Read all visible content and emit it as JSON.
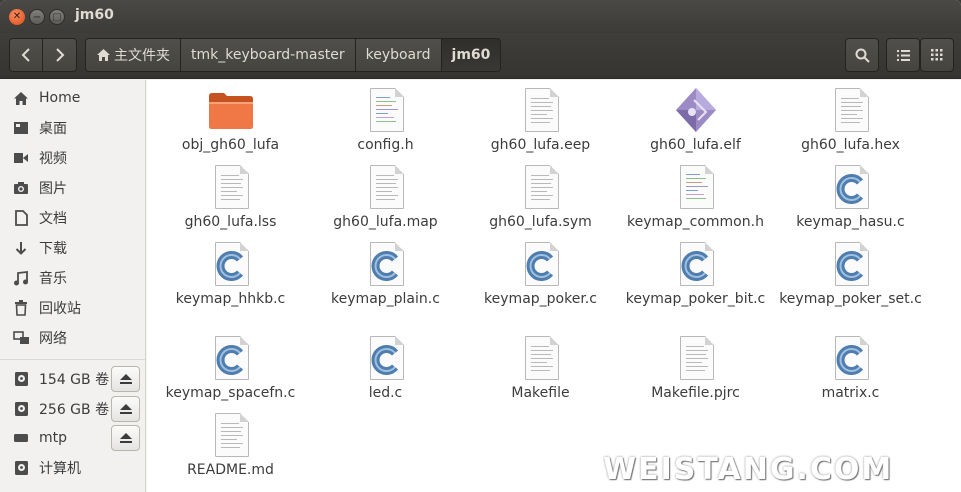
{
  "window": {
    "title": "jm60"
  },
  "breadcrumb": [
    "主文件夹",
    "tmk_keyboard-master",
    "keyboard",
    "jm60"
  ],
  "sidebar": {
    "places": [
      {
        "label": "Home",
        "icon": "home-icon"
      },
      {
        "label": "桌面",
        "icon": "desktop-icon"
      },
      {
        "label": "视频",
        "icon": "video-icon"
      },
      {
        "label": "图片",
        "icon": "camera-icon"
      },
      {
        "label": "文档",
        "icon": "document-icon"
      },
      {
        "label": "下载",
        "icon": "download-icon"
      },
      {
        "label": "音乐",
        "icon": "music-icon"
      },
      {
        "label": "回收站",
        "icon": "trash-icon"
      },
      {
        "label": "网络",
        "icon": "network-icon"
      }
    ],
    "devices": [
      {
        "label": "154 GB 卷",
        "icon": "drive-icon"
      },
      {
        "label": "256 GB 卷",
        "icon": "drive-icon"
      },
      {
        "label": "mtp",
        "icon": "phone-icon"
      },
      {
        "label": "计算机",
        "icon": "computer-icon"
      }
    ]
  },
  "files": [
    {
      "name": "obj_gh60_lufa",
      "type": "folder"
    },
    {
      "name": "config.h",
      "type": "header"
    },
    {
      "name": "gh60_lufa.eep",
      "type": "text"
    },
    {
      "name": "gh60_lufa.elf",
      "type": "binary"
    },
    {
      "name": "gh60_lufa.hex",
      "type": "text"
    },
    {
      "name": "gh60_lufa.lss",
      "type": "text"
    },
    {
      "name": "gh60_lufa.map",
      "type": "text"
    },
    {
      "name": "gh60_lufa.sym",
      "type": "text"
    },
    {
      "name": "keymap_common.h",
      "type": "header"
    },
    {
      "name": "keymap_hasu.c",
      "type": "c"
    },
    {
      "name": "keymap_hhkb.c",
      "type": "c"
    },
    {
      "name": "keymap_plain.c",
      "type": "c"
    },
    {
      "name": "keymap_poker.c",
      "type": "c"
    },
    {
      "name": "keymap_poker_bit.c",
      "type": "c"
    },
    {
      "name": "keymap_poker_set.c",
      "type": "c"
    },
    {
      "name": "keymap_spacefn.c",
      "type": "c"
    },
    {
      "name": "led.c",
      "type": "c"
    },
    {
      "name": "Makefile",
      "type": "text"
    },
    {
      "name": "Makefile.pjrc",
      "type": "text"
    },
    {
      "name": "matrix.c",
      "type": "c"
    },
    {
      "name": "README.md",
      "type": "text"
    }
  ],
  "watermark": "WEISTANG.COM",
  "colors": {
    "titlebar": "#3c3b37",
    "folder": "#f07746",
    "c_badge": "#4f7dae"
  }
}
